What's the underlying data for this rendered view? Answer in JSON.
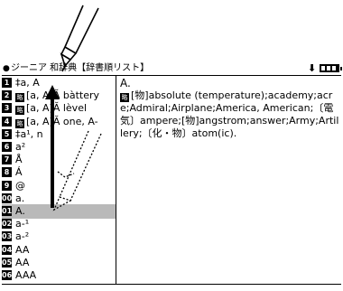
{
  "titlebar": {
    "dot": "●",
    "title": "ジーニア 和辞典【辞書順リスト】",
    "arrow": "⬇"
  },
  "list": {
    "rows": [
      {
        "num": "1",
        "badge": "",
        "text": "‡a, A"
      },
      {
        "num": "2",
        "badge": "略",
        "text": "[a, A]Ă bàttery"
      },
      {
        "num": "3",
        "badge": "略",
        "text": "[a, A]Ă lèvel"
      },
      {
        "num": "4",
        "badge": "略",
        "text": "[a, A]Ă one, A-"
      },
      {
        "num": "5",
        "badge": "",
        "text": "‡a¹,        n"
      },
      {
        "num": "6",
        "badge": "",
        "text": "a²"
      },
      {
        "num": "7",
        "badge": "",
        "text": "Å"
      },
      {
        "num": "8",
        "badge": "",
        "text": "Á"
      },
      {
        "num": "9",
        "badge": "",
        "text": "@"
      },
      {
        "num": "00",
        "badge": "",
        "text": "a."
      },
      {
        "num": "01",
        "badge": "",
        "text": "A."
      },
      {
        "num": "02",
        "badge": "",
        "text": "a-¹"
      },
      {
        "num": "03",
        "badge": "",
        "text": "a-²"
      },
      {
        "num": "04",
        "badge": "",
        "text": "AA"
      },
      {
        "num": "05",
        "badge": "",
        "text": "AA"
      },
      {
        "num": "06",
        "badge": "",
        "text": "AAA"
      }
    ],
    "selected_row": "01"
  },
  "detail": {
    "headword": "A.",
    "badge": "略",
    "body": "[物]absolute (temperature);academy;acre;Admiral;Airplane;America, American;〔電気〕ampere;[物]angstrom;answer;Army;Artillery;〔化・物〕atom(ic)."
  }
}
